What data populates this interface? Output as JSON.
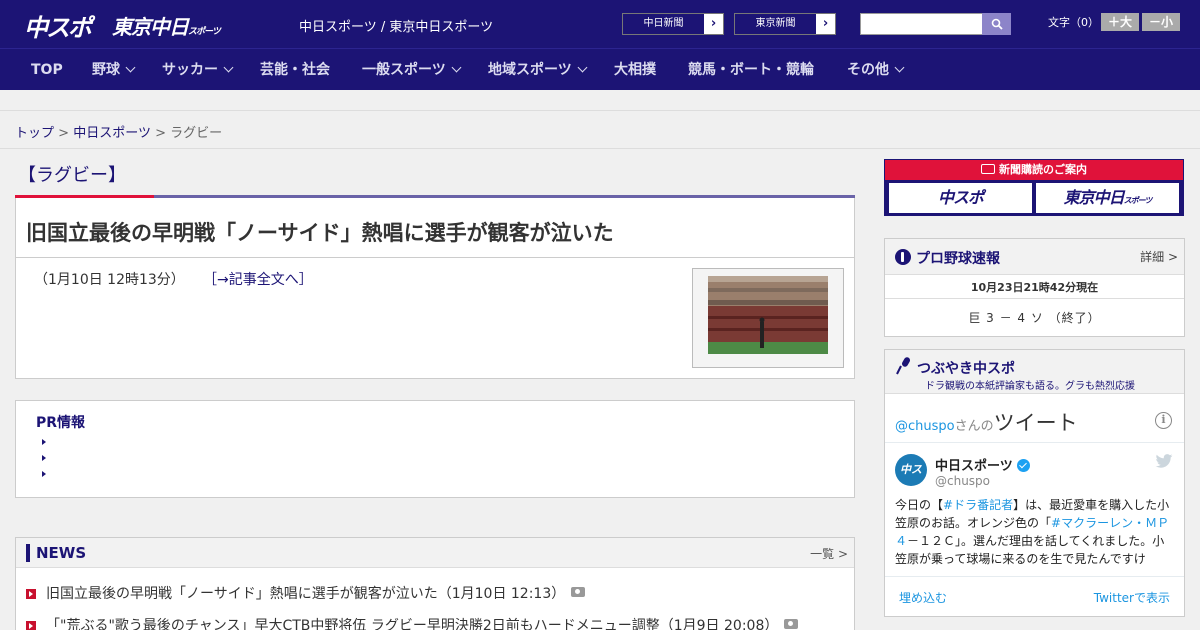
{
  "header": {
    "logo_chuspo": "中スポ",
    "logo_tokyo": "東京中日",
    "logo_tokyo_small": "スポーツ",
    "site_names": "中日スポーツ / 東京中日スポーツ",
    "paper_buttons": [
      "中日新聞",
      "東京新聞"
    ],
    "search_placeholder": "",
    "font_label": "文字（0）",
    "font_large": "＋大",
    "font_small": "－小"
  },
  "nav": [
    {
      "label": "TOP",
      "dropdown": false
    },
    {
      "label": "野球",
      "dropdown": true
    },
    {
      "label": "サッカー",
      "dropdown": true
    },
    {
      "label": "芸能・社会",
      "dropdown": false
    },
    {
      "label": "一般スポーツ",
      "dropdown": true
    },
    {
      "label": "地域スポーツ",
      "dropdown": true
    },
    {
      "label": "大相撲",
      "dropdown": false
    },
    {
      "label": "競馬・ボート・競輪",
      "dropdown": false
    },
    {
      "label": "その他",
      "dropdown": true
    }
  ],
  "breadcrumb": {
    "items": [
      "トップ",
      "中日スポーツ",
      "ラグビー"
    ],
    "separator": ">"
  },
  "article": {
    "category": "【ラグビー】",
    "headline": "旧国立最後の早明戦「ノーサイド」熱唱に選手が観客が泣いた",
    "date": "（1月10日 12時13分）",
    "full_link": "［→記事全文へ］"
  },
  "pr": {
    "title": "PR情報"
  },
  "news": {
    "title": "NEWS",
    "more": "一覧 >",
    "items": [
      {
        "text": "旧国立最後の早明戦「ノーサイド」熱唱に選手が観客が泣いた（1月10日 12:13）",
        "photo": true
      },
      {
        "text": "「\"荒ぶる\"歌う最後のチャンス」早大CTB中野将伍 ラグビー早明決勝2日前もハードメニュー調整（1月9日 20:08）",
        "photo": true
      }
    ]
  },
  "subscription": {
    "heading": "新聞購読のご案内",
    "logo_chuspo": "中スポ",
    "logo_tokyo": "東京中日",
    "logo_tokyo_small": "スポーツ"
  },
  "baseball": {
    "title": "プロ野球速報",
    "more": "詳細 >",
    "time": "10月23日21時42分現在",
    "score": "巨 3 － 4 ソ （終了）"
  },
  "twitter": {
    "title": "つぶやき中スポ",
    "subtitle": "ドラ観戦の本紙評論家も語る。グラも熱烈応援",
    "handle": "@chuspo",
    "handle_suffix": "さんの",
    "tweet_word": "ツイート",
    "account_name": "中日スポーツ",
    "account_at": "@chuspo",
    "avatar_text": "中スポ",
    "tweet_parts": [
      {
        "text": "今日の【",
        "tag": false
      },
      {
        "text": "#ドラ番記者",
        "tag": true
      },
      {
        "text": "】は、最近愛車を購入した小笠原のお話。オレンジ色の「",
        "tag": false
      },
      {
        "text": "#マクラーレン・ＭＰ４",
        "tag": true
      },
      {
        "text": "－１２Ｃ」。選んだ理由を話してくれました。小笠原が乗って球場に来るのを生で見たんですけ",
        "tag": false
      }
    ],
    "embed": "埋め込む",
    "view": "Twitterで表示"
  },
  "colors": {
    "brand_navy": "#1c1475",
    "accent_red": "#e0123a",
    "twitter_blue": "#1b95e0"
  }
}
